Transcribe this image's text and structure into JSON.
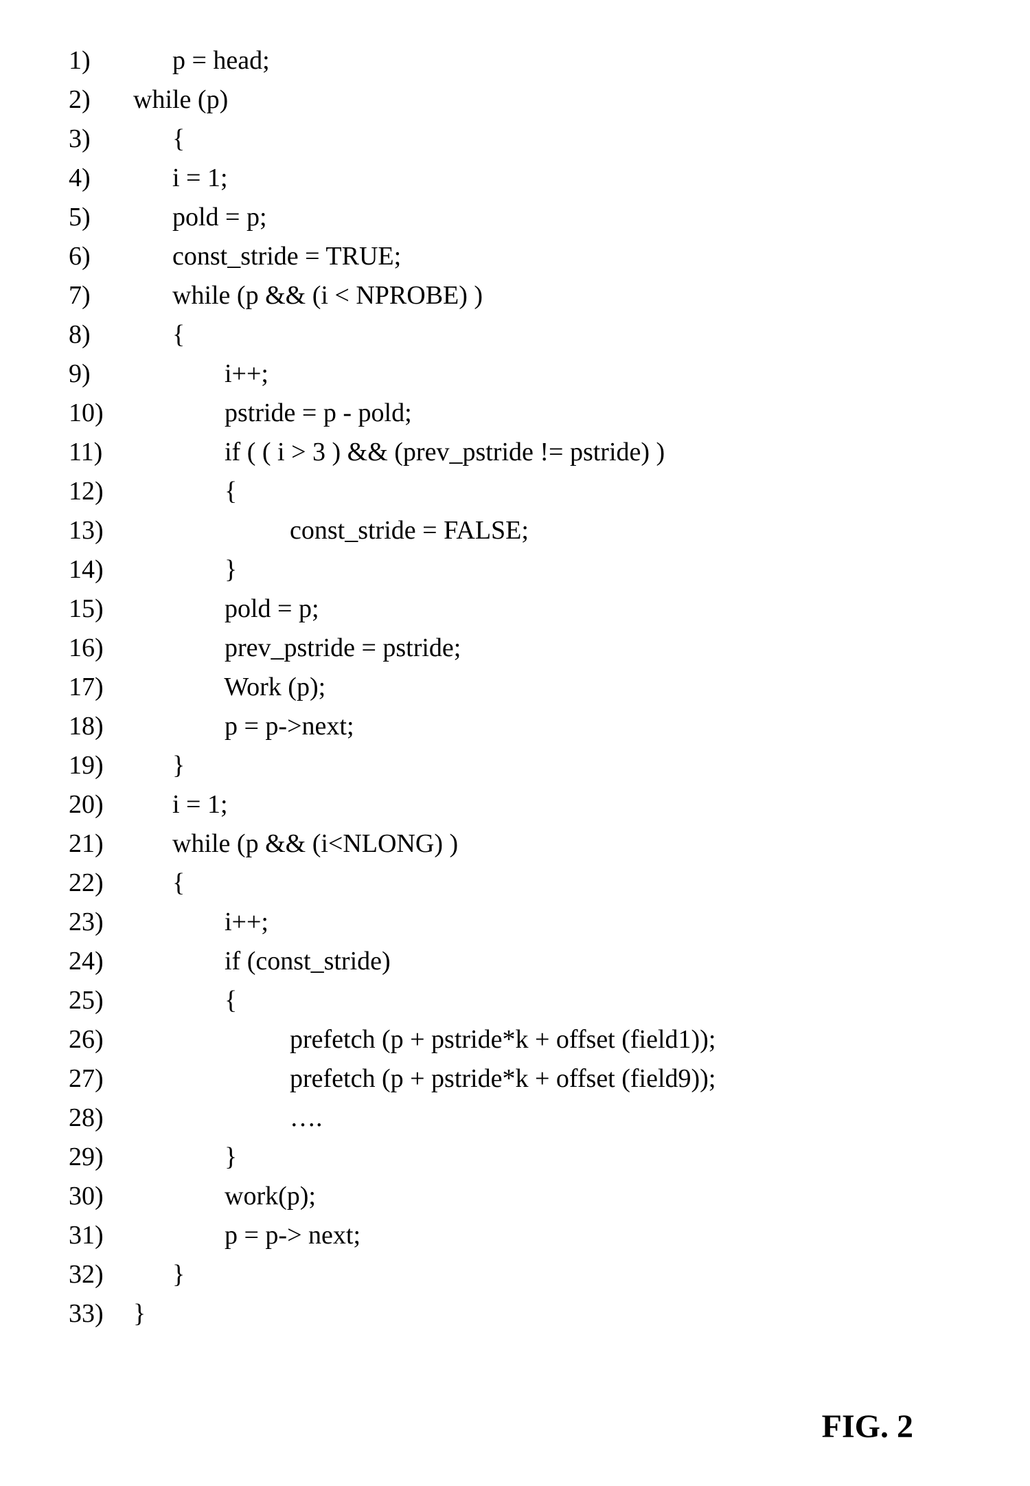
{
  "code": {
    "lines": [
      {
        "n": "1)",
        "indent": "        ",
        "text": "p = head;"
      },
      {
        "n": "2)",
        "indent": "  ",
        "text": "while (p)"
      },
      {
        "n": "3)",
        "indent": "        ",
        "text": "{"
      },
      {
        "n": "4)",
        "indent": "        ",
        "text": "i = 1;"
      },
      {
        "n": "5)",
        "indent": "        ",
        "text": "pold = p;"
      },
      {
        "n": "6)",
        "indent": "        ",
        "text": "const_stride = TRUE;"
      },
      {
        "n": "7)",
        "indent": "        ",
        "text": "while (p && (i < NPROBE) )"
      },
      {
        "n": "8)",
        "indent": "        ",
        "text": "{"
      },
      {
        "n": "9)",
        "indent": "                ",
        "text": "i++;"
      },
      {
        "n": "10)",
        "indent": "                ",
        "text": "pstride = p - pold;"
      },
      {
        "n": "11)",
        "indent": "                ",
        "text": "if ( ( i > 3 ) && (prev_pstride != pstride) )"
      },
      {
        "n": "12)",
        "indent": "                ",
        "text": "{"
      },
      {
        "n": "13)",
        "indent": "                          ",
        "text": "const_stride = FALSE;"
      },
      {
        "n": "14)",
        "indent": "                ",
        "text": "}"
      },
      {
        "n": "15)",
        "indent": "                ",
        "text": "pold = p;"
      },
      {
        "n": "16)",
        "indent": "                ",
        "text": "prev_pstride = pstride;"
      },
      {
        "n": "17)",
        "indent": "                ",
        "text": "Work (p);"
      },
      {
        "n": "18)",
        "indent": "                ",
        "text": "p = p->next;"
      },
      {
        "n": "19)",
        "indent": "        ",
        "text": "}"
      },
      {
        "n": "20)",
        "indent": "        ",
        "text": "i = 1;"
      },
      {
        "n": "21)",
        "indent": "        ",
        "text": "while (p && (i<NLONG) )"
      },
      {
        "n": "22)",
        "indent": "        ",
        "text": "{"
      },
      {
        "n": "23)",
        "indent": "                ",
        "text": "i++;"
      },
      {
        "n": "24)",
        "indent": "                ",
        "text": "if (const_stride)"
      },
      {
        "n": "25)",
        "indent": "                ",
        "text": "{"
      },
      {
        "n": "26)",
        "indent": "                          ",
        "text": "prefetch (p + pstride*k + offset (field1));"
      },
      {
        "n": "27)",
        "indent": "                          ",
        "text": "prefetch (p + pstride*k + offset (field9));"
      },
      {
        "n": "28)",
        "indent": "                          ",
        "text": "…."
      },
      {
        "n": "29)",
        "indent": "                ",
        "text": "}"
      },
      {
        "n": "30)",
        "indent": "                ",
        "text": "work(p);"
      },
      {
        "n": "31)",
        "indent": "                ",
        "text": "p = p-> next;"
      },
      {
        "n": "32)",
        "indent": "        ",
        "text": "}"
      },
      {
        "n": "33)",
        "indent": "  ",
        "text": "}"
      }
    ]
  },
  "figure_label": "FIG. 2"
}
